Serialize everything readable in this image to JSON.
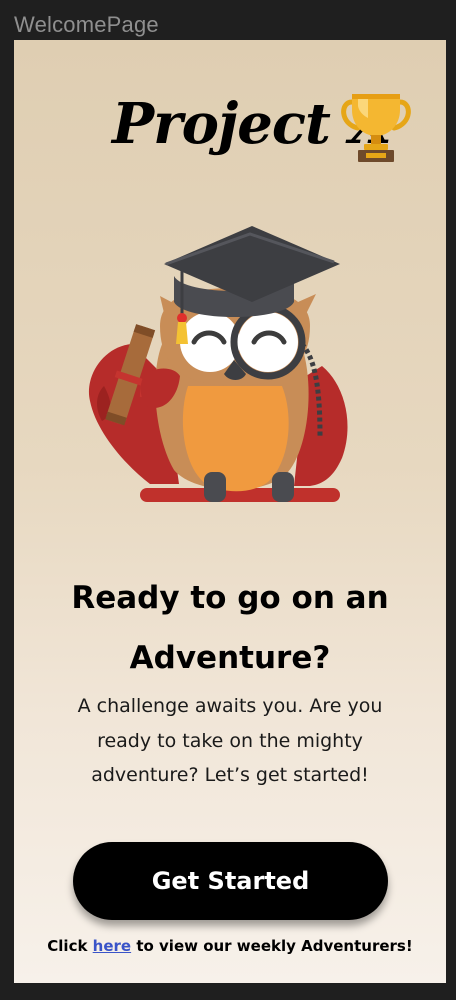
{
  "window": {
    "title": "WelcomePage"
  },
  "brand": {
    "title": "Project X",
    "icon": "trophy-icon"
  },
  "hero": {
    "illustration": "graduate-owl-illustration"
  },
  "headline": {
    "line1": "Ready to go on an",
    "line2": "Adventure?"
  },
  "description": {
    "line1": "A challenge awaits you. Are you",
    "line2": "ready to take on the mighty",
    "line3": "adventure? Let’s get started!"
  },
  "cta": {
    "label": "Get Started"
  },
  "footer": {
    "prefix": "Click ",
    "link": "here",
    "suffix": " to view our weekly Adventurers!"
  },
  "colors": {
    "background_top": "#dfceb2",
    "background_bottom": "#f7f1ea",
    "button": "#000000",
    "link": "#3a54c8"
  }
}
